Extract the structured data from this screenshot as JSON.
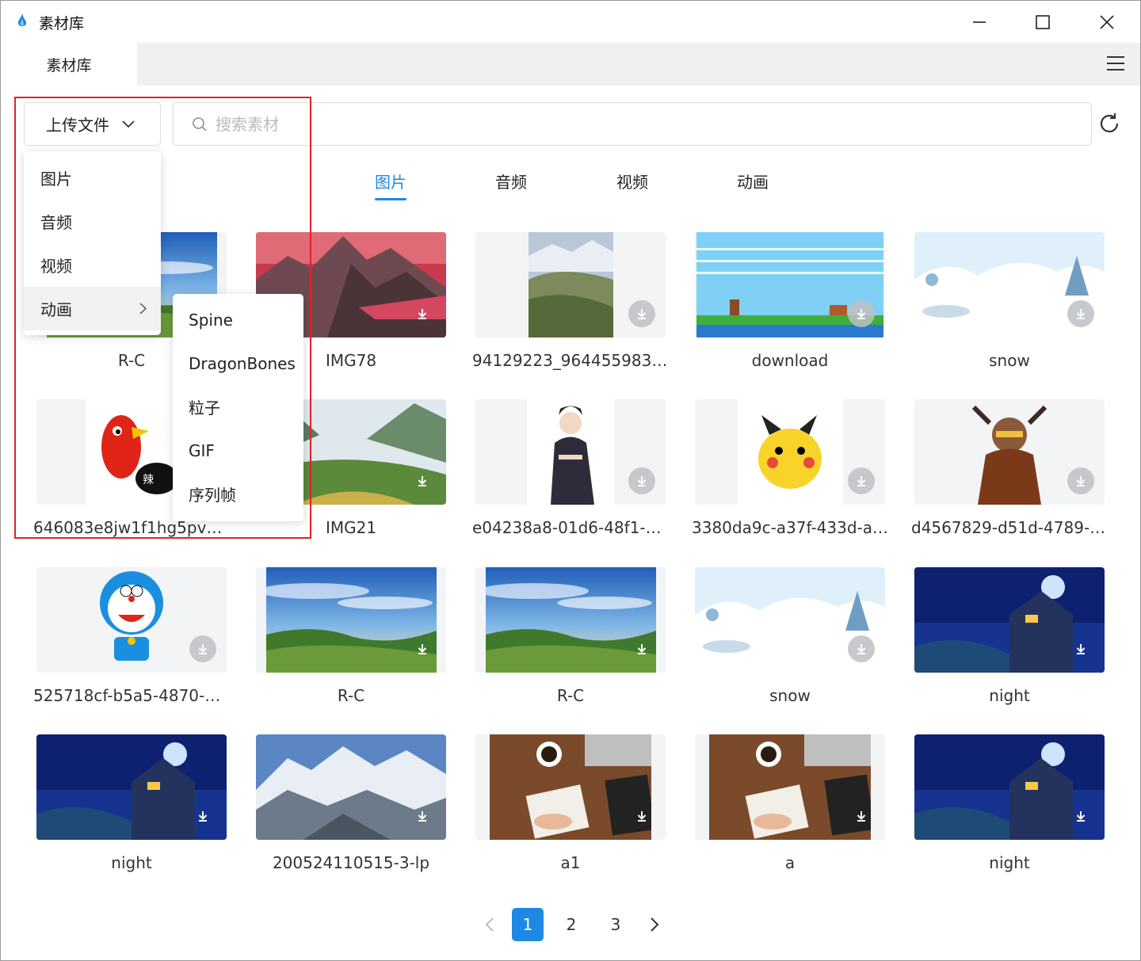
{
  "window": {
    "title": "素材库",
    "controls": [
      "minimize-icon",
      "maximize-icon",
      "close-icon"
    ]
  },
  "tabbar": {
    "tab": "素材库",
    "menu_icon": "hamburger-menu-icon"
  },
  "toolbar": {
    "upload_label": "上传文件",
    "search_placeholder": "搜索素材",
    "refresh_icon": "refresh-icon"
  },
  "upload_menu": {
    "items": [
      "图片",
      "音频",
      "视频",
      "动画"
    ],
    "hovered": "动画"
  },
  "animation_submenu": {
    "items": [
      "Spine",
      "DragonBones",
      "粒子",
      "GIF",
      "序列帧"
    ]
  },
  "category_tabs": {
    "items": [
      "图片",
      "音频",
      "视频",
      "动画"
    ],
    "active": "图片"
  },
  "grid": {
    "items": [
      {
        "name": "R-C",
        "thumb": "landscape-sky"
      },
      {
        "name": "IMG78",
        "thumb": "red-mountains"
      },
      {
        "name": "94129223_96445598397...",
        "thumb": "valley-hills"
      },
      {
        "name": "download",
        "thumb": "pixel-game"
      },
      {
        "name": "snow",
        "thumb": "snow-scene"
      },
      {
        "name": "646083e8jw1f1hg5pv0a3...",
        "thumb": "red-bird-cartoon"
      },
      {
        "name": "IMG21",
        "thumb": "misty-valley"
      },
      {
        "name": "e04238a8-01d6-48f1-a1...",
        "thumb": "anime-character"
      },
      {
        "name": "3380da9c-a37f-433d-a5...",
        "thumb": "pikachu"
      },
      {
        "name": "d4567829-d51d-4789-bc...",
        "thumb": "warrior-character"
      },
      {
        "name": "525718cf-b5a5-4870-bf0...",
        "thumb": "doraemon"
      },
      {
        "name": "R-C",
        "thumb": "landscape-sky"
      },
      {
        "name": "R-C",
        "thumb": "landscape-sky"
      },
      {
        "name": "snow",
        "thumb": "snow-scene"
      },
      {
        "name": "night",
        "thumb": "night-house"
      },
      {
        "name": "night",
        "thumb": "night-house"
      },
      {
        "name": "200524110515-3-lp",
        "thumb": "snow-mountains"
      },
      {
        "name": "a1",
        "thumb": "desk-coffee"
      },
      {
        "name": "a",
        "thumb": "desk-coffee"
      },
      {
        "name": "night",
        "thumb": "night-house"
      }
    ]
  },
  "pagination": {
    "pages": [
      "1",
      "2",
      "3"
    ],
    "current": "1",
    "prev_icon": "prev-icon",
    "next_icon": "next-icon"
  },
  "colors": {
    "accent": "#1e88e5",
    "highlight_box": "#e0212b"
  }
}
